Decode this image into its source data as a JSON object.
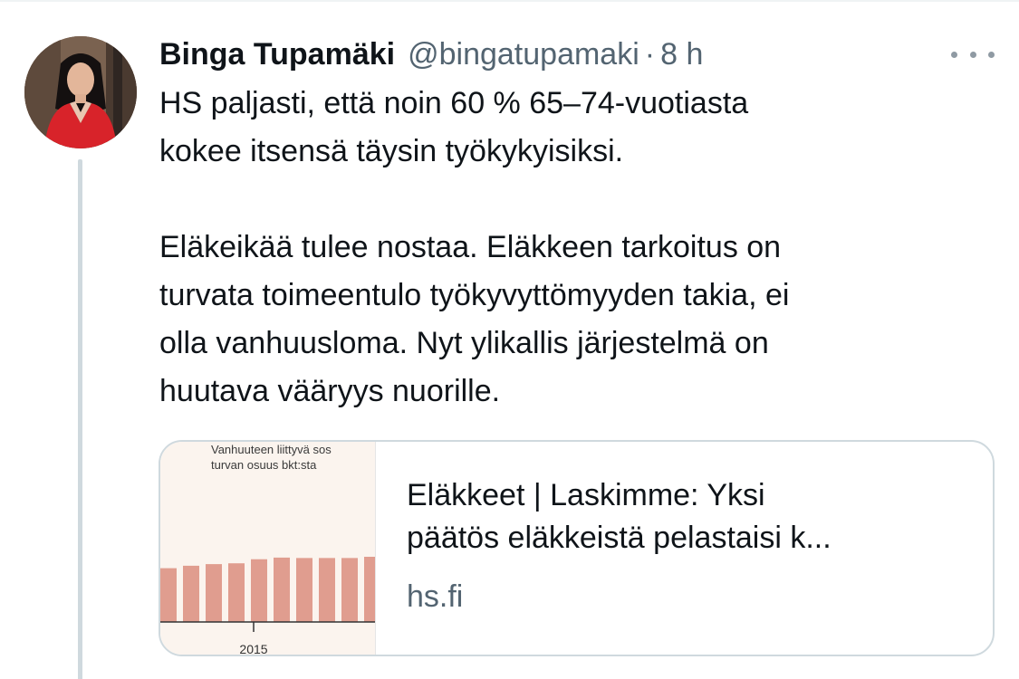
{
  "tweet": {
    "author_name": "Binga Tupamäki",
    "author_handle": "@bingatupamaki",
    "separator": "·",
    "timestamp": "8 h",
    "paragraphs": [
      [
        "HS paljasti, että noin 60 % 65–74-vuotiasta",
        "kokee itsensä täysin työkykyisiksi."
      ],
      [
        "Eläkeikää tulee nostaa. Eläkkeen tarkoitus on",
        "turvata toimeentulo työkyvyttömyyden takia, ei",
        "olla vanhuusloma. Nyt ylikallis järjestelmä on",
        "huutava vääryys nuorille."
      ]
    ]
  },
  "link_card": {
    "title_lines": [
      "Eläkkeet | Laskimme: Yksi",
      "päätös eläkkeistä pelastaisi k..."
    ],
    "domain": "hs.fi",
    "thumbnail": {
      "caption_lines": [
        "Vanhuuteen liittyvä sos",
        "turvan osuus bkt:sta"
      ],
      "axis_tick": "2015",
      "bar_values": [
        6.6,
        6.9,
        7.1,
        7.2,
        7.7,
        7.9,
        7.85,
        7.85,
        7.85,
        8.0
      ],
      "value_max": 10,
      "bar_color": "#e09d8f"
    }
  },
  "colors": {
    "text_primary": "#0f1419",
    "text_secondary": "#536471",
    "border": "#cfd9de",
    "avatar_jacket": "#d8232a"
  }
}
